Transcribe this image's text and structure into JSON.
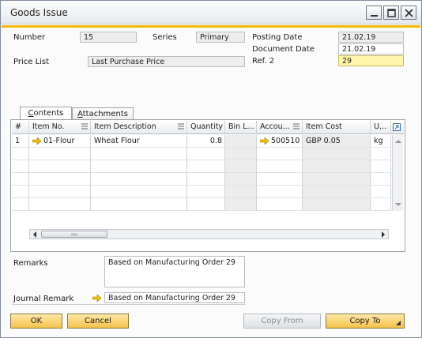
{
  "window": {
    "title": "Goods Issue"
  },
  "header": {
    "number_label": "Number",
    "number_value": "15",
    "series_label": "Series",
    "series_value": "Primary",
    "price_list_label": "Price List",
    "price_list_value": "Last Purchase Price",
    "posting_date_label": "Posting Date",
    "posting_date_value": "21.02.19",
    "document_date_label": "Document Date",
    "document_date_value": "21.02.19",
    "ref2_label": "Ref. 2",
    "ref2_value": "29"
  },
  "tabs": [
    {
      "label": "Contents",
      "active": true
    },
    {
      "label": "Attachments",
      "active": false
    }
  ],
  "table": {
    "columns": [
      "#",
      "Item No.",
      "Item Description",
      "Quantity",
      "Bin L...",
      "Accou...",
      "Item Cost",
      "U..."
    ],
    "rows": [
      {
        "num": "1",
        "item_no": "01-Flour",
        "description": "Wheat Flour",
        "quantity": "0.8",
        "bin": "",
        "account": "500510",
        "item_cost": "GBP 0.05",
        "uom": "kg"
      }
    ],
    "empty_rows": 5
  },
  "footer": {
    "remarks_label": "Remarks",
    "remarks_value": "Based on Manufacturing Order 29",
    "journal_remark_label": "Journal Remark",
    "journal_remark_value": "Based on Manufacturing Order 29"
  },
  "buttons": {
    "ok": "OK",
    "cancel": "Cancel",
    "copy_from": "Copy From",
    "copy_to": "Copy To"
  },
  "colors": {
    "accent": "#f5b800",
    "button": "#f5c34b",
    "highlight_field": "#fff6a9"
  }
}
